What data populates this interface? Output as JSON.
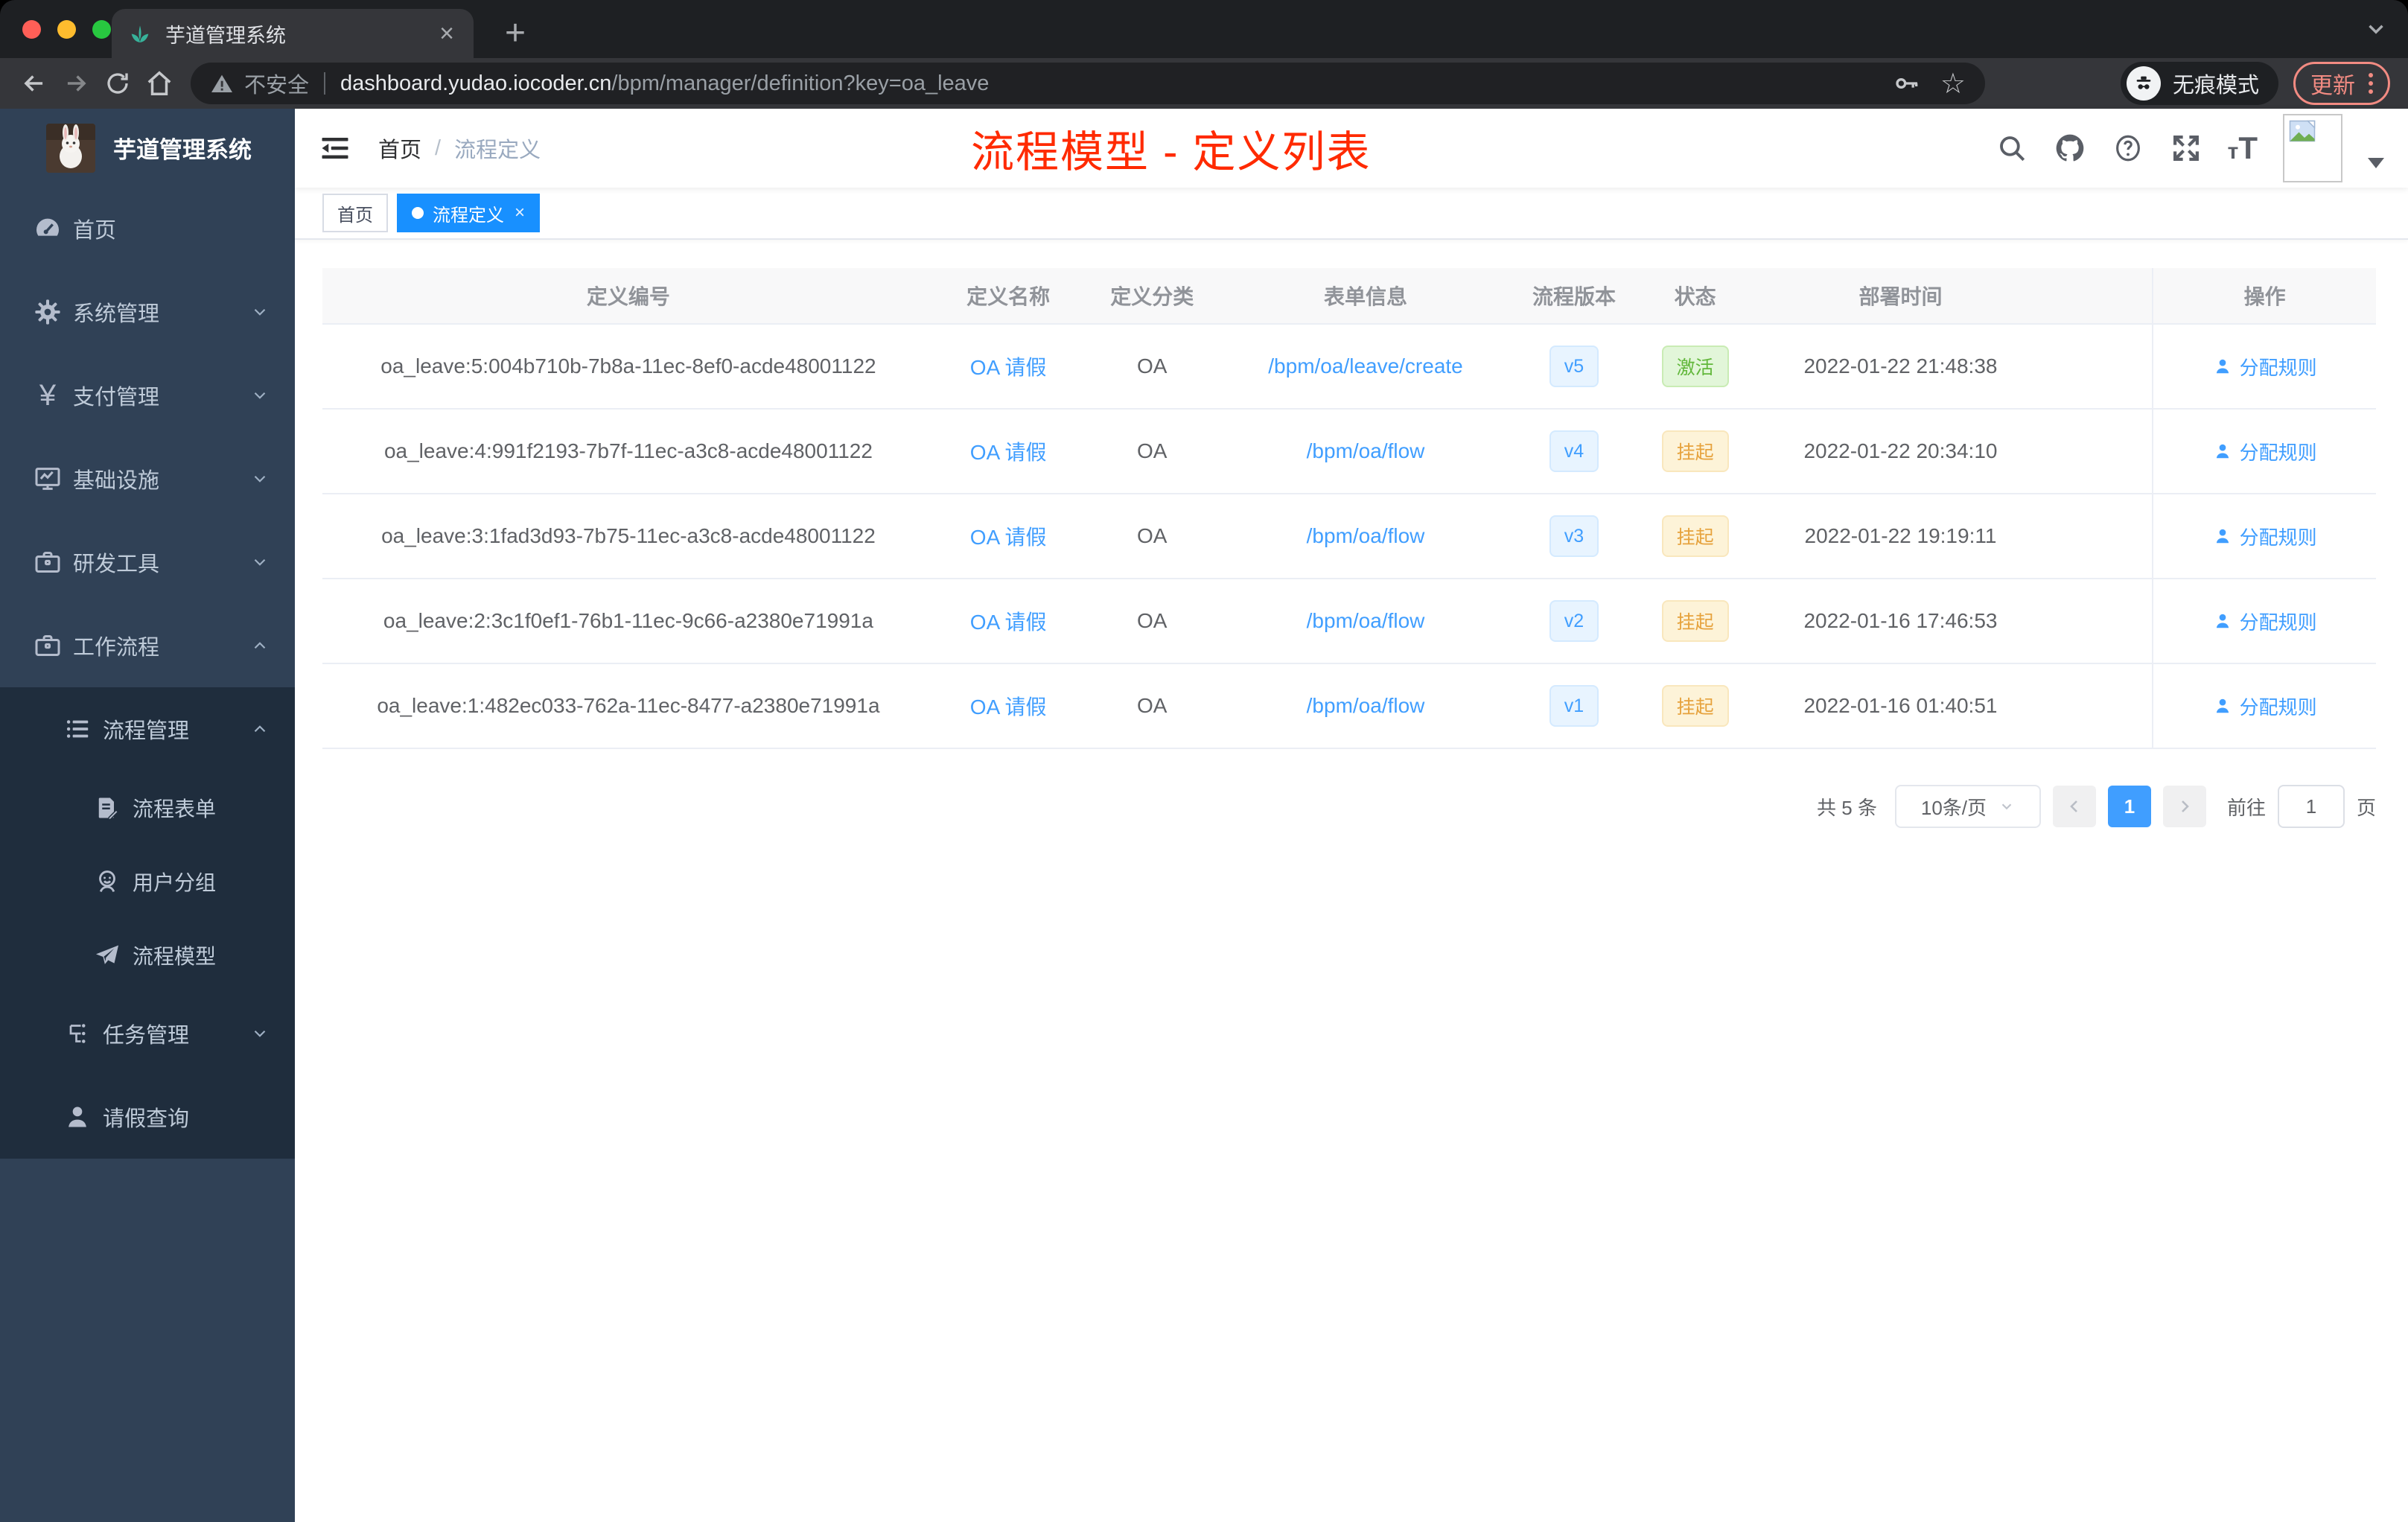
{
  "browser": {
    "tab_title": "芋道管理系统",
    "security_label": "不安全",
    "url_host": "dashboard.yudao.iocoder.cn",
    "url_path": "/bpm/manager/definition?key=oa_leave",
    "incognito_label": "无痕模式",
    "update_label": "更新"
  },
  "sidebar": {
    "logo_title": "芋道管理系统",
    "items": [
      {
        "label": "首页"
      },
      {
        "label": "系统管理"
      },
      {
        "label": "支付管理"
      },
      {
        "label": "基础设施"
      },
      {
        "label": "研发工具"
      },
      {
        "label": "工作流程"
      }
    ],
    "workflow_submenu": {
      "process_management": "流程管理",
      "process_form": "流程表单",
      "user_group": "用户分组",
      "process_model": "流程模型",
      "task_management": "任务管理",
      "leave_query": "请假查询"
    }
  },
  "header": {
    "breadcrumb_home": "首页",
    "breadcrumb_current": "流程定义",
    "overlay_title": "流程模型 - 定义列表"
  },
  "tags": {
    "home": "首页",
    "active": "流程定义"
  },
  "table": {
    "headers": [
      "定义编号",
      "定义名称",
      "定义分类",
      "表单信息",
      "流程版本",
      "状态",
      "部署时间",
      "操作"
    ],
    "action_label": "分配规则",
    "rows": [
      {
        "id": "oa_leave:5:004b710b-7b8a-11ec-8ef0-acde48001122",
        "name": "OA 请假",
        "category": "OA",
        "form": "/bpm/oa/leave/create",
        "version": "v5",
        "status": "激活",
        "status_type": "success",
        "deploy_time": "2022-01-22 21:48:38"
      },
      {
        "id": "oa_leave:4:991f2193-7b7f-11ec-a3c8-acde48001122",
        "name": "OA 请假",
        "category": "OA",
        "form": "/bpm/oa/flow",
        "version": "v4",
        "status": "挂起",
        "status_type": "warning",
        "deploy_time": "2022-01-22 20:34:10"
      },
      {
        "id": "oa_leave:3:1fad3d93-7b75-11ec-a3c8-acde48001122",
        "name": "OA 请假",
        "category": "OA",
        "form": "/bpm/oa/flow",
        "version": "v3",
        "status": "挂起",
        "status_type": "warning",
        "deploy_time": "2022-01-22 19:19:11"
      },
      {
        "id": "oa_leave:2:3c1f0ef1-76b1-11ec-9c66-a2380e71991a",
        "name": "OA 请假",
        "category": "OA",
        "form": "/bpm/oa/flow",
        "version": "v2",
        "status": "挂起",
        "status_type": "warning",
        "deploy_time": "2022-01-16 17:46:53"
      },
      {
        "id": "oa_leave:1:482ec033-762a-11ec-8477-a2380e71991a",
        "name": "OA 请假",
        "category": "OA",
        "form": "/bpm/oa/flow",
        "version": "v1",
        "status": "挂起",
        "status_type": "warning",
        "deploy_time": "2022-01-16 01:40:51"
      }
    ]
  },
  "pagination": {
    "total": "共 5 条",
    "page_size": "10条/页",
    "current_page": "1",
    "goto_label": "前往",
    "goto_value": "1",
    "page_unit": "页"
  },
  "colors": {
    "accent_blue": "#409eff",
    "active_tag_blue": "#1890ff",
    "success_green": "#67c23a",
    "warning_orange": "#e6a23c",
    "annotation_red": "#ff2a00",
    "sidebar_bg": "#304156",
    "sidebar_submenu_bg": "#1f2d3d"
  }
}
